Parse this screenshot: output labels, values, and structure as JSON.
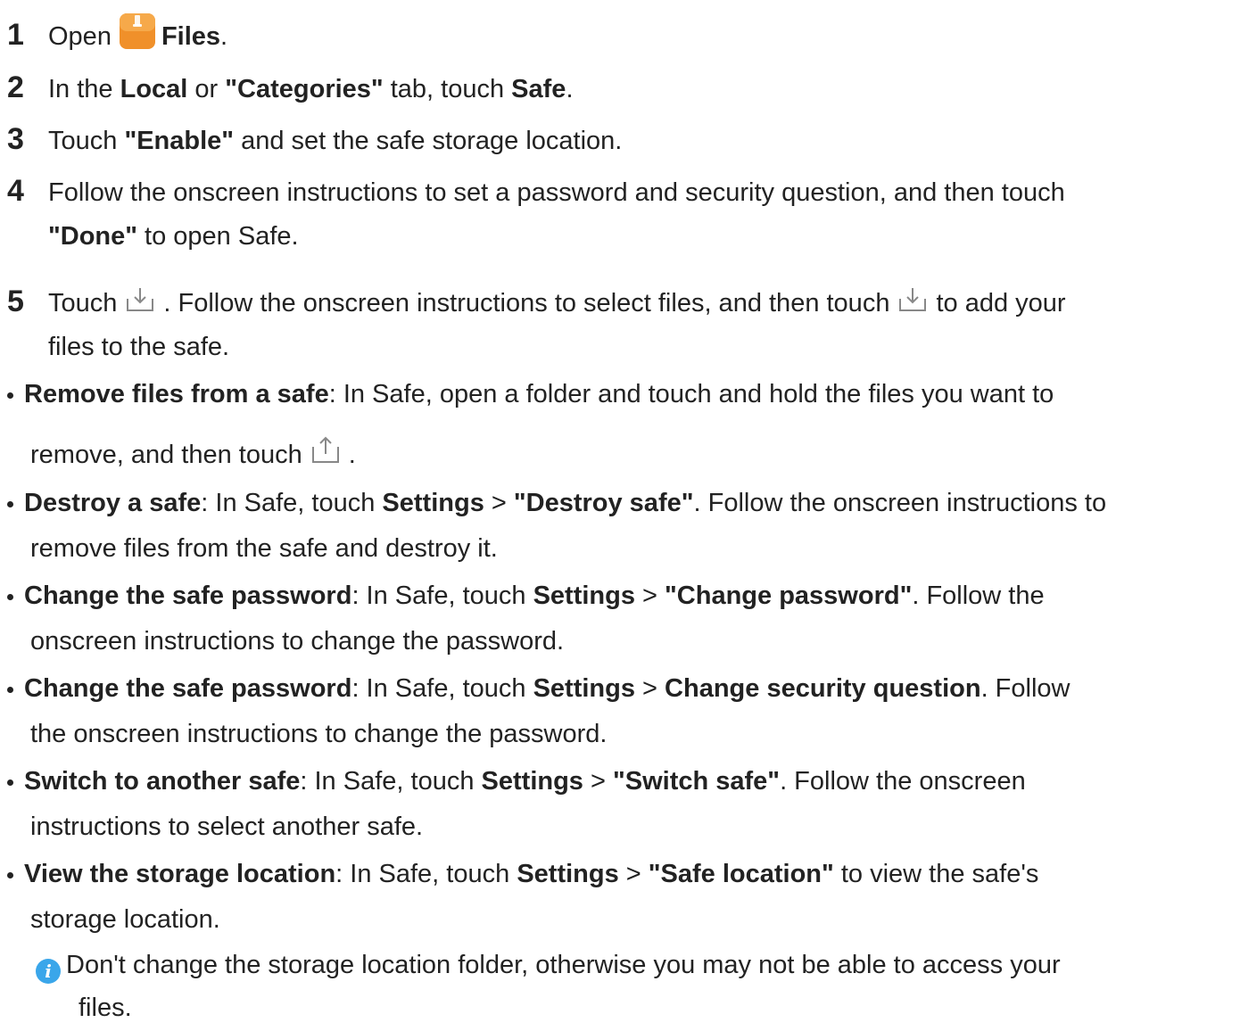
{
  "steps": [
    {
      "num": "1",
      "t1": "Open",
      "b1": "Files",
      "t2": "."
    },
    {
      "num": "2",
      "t1": "In the ",
      "b1": "Local",
      "t2": " or ",
      "b2": "\"Categories\"",
      "t3": " tab, touch ",
      "b3": "Safe",
      "t4": "."
    },
    {
      "num": "3",
      "t1": "Touch ",
      "b1": "\"Enable\"",
      "t2": " and set the safe storage location."
    },
    {
      "num": "4",
      "t1": "Follow the onscreen instructions to set a password and security question, and then touch",
      "b1": "\"Done\"",
      "t2": " to open Safe."
    },
    {
      "num": "5",
      "t1": "Touch",
      "t2": ". Follow the onscreen instructions to select files, and then touch",
      "t3": "to add your",
      "t4": "files to the safe."
    }
  ],
  "bullets": [
    {
      "b": "Remove files from a safe",
      "t1": ": In Safe, open a folder and touch and hold the files you want to",
      "t2": "remove, and then touch",
      "t3": "."
    },
    {
      "b": "Destroy a safe",
      "t1": ": In Safe, touch ",
      "b2": "Settings",
      "t2": " > ",
      "b3": "\"Destroy safe\"",
      "t3": ". Follow the onscreen instructions to",
      "t4": "remove files from the safe and destroy it."
    },
    {
      "b": "Change the safe password",
      "t1": ": In Safe, touch ",
      "b2": "Settings",
      "t2": " > ",
      "b3": "\"Change password\"",
      "t3": ". Follow the",
      "t4": "onscreen instructions to change the password."
    },
    {
      "b": "Change the safe password",
      "t1": ": In Safe, touch ",
      "b2": "Settings",
      "t2": " > ",
      "b3": "Change security question",
      "t3": ". Follow",
      "t4": "the onscreen instructions to change the password."
    },
    {
      "b": "Switch to another safe",
      "t1": ": In Safe, touch ",
      "b2": "Settings",
      "t2": " > ",
      "b3": "\"Switch safe\"",
      "t3": ". Follow the onscreen",
      "t4": "instructions to select another safe."
    },
    {
      "b": "View the storage location",
      "t1": ": In Safe, touch ",
      "b2": "Settings",
      "t2": " > ",
      "b3": "\"Safe location\"",
      "t3": " to view the safe's",
      "t4": "storage location."
    }
  ],
  "note": {
    "icon": "info-icon",
    "line1": "Don't change the storage location folder, otherwise you may not be able to access your",
    "line2": "files."
  },
  "colors": {
    "text": "#222222",
    "files_icon": "#f0902a",
    "info_icon": "#3aa6ea"
  }
}
